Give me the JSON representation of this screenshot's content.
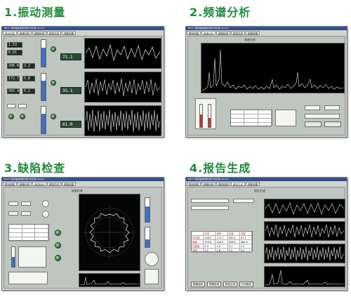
{
  "panels": [
    {
      "heading": "1.振动测量"
    },
    {
      "heading": "2.频谱分析"
    },
    {
      "heading": "3.缺陷检查"
    },
    {
      "heading": "4.报告生成"
    }
  ],
  "panel1": {
    "title": "BZ47-I滚动轴承故障诊断分析系统 Version",
    "tabs": [
      "振动测量",
      "频谱分析",
      "缺陷检测",
      "报告生成",
      "参数设置"
    ],
    "readouts": [
      "1.53",
      "0.61",
      "206.0",
      "2.2",
      "172.7",
      "5.8",
      "392.4",
      "5.2"
    ],
    "big_values": [
      "72.1",
      "35.1",
      "61.0"
    ]
  },
  "panel2": {
    "title": "BZ47-I滚动轴承故障诊断分析系统 Version",
    "tabs": [
      "振动测量",
      "频谱分析",
      "缺陷检测",
      "报告生成",
      "参数设置"
    ],
    "header": "频谱分析"
  },
  "panel3": {
    "title": "BZ47-I滚动轴承故障诊断分析系统 Version",
    "tabs": [
      "振动测量",
      "频谱分析",
      "缺陷检测",
      "报告生成",
      "参数设置"
    ],
    "header": "缺陷检查"
  },
  "panel4": {
    "title": "BZ47-I滚动轴承故障诊断分析系统 Version",
    "tabs": [
      "振动测量",
      "频谱分析",
      "缺陷检测",
      "报告生成",
      "参数设置"
    ],
    "header": "报告生成",
    "table_header": [
      "",
      "时间",
      "频率",
      "外圈",
      "内圈"
    ],
    "table_rows": [
      [
        "时间频",
        "136.0",
        "172.7",
        "392.4",
        "57.1"
      ],
      [
        "幅值",
        "133.8",
        "204.0",
        "426.6",
        "464.5"
      ],
      [
        "加速度",
        "2.3",
        "3.5",
        "5.1",
        "2.2"
      ],
      [
        "速度",
        "2.2",
        "2.8",
        "5.2",
        "5.2"
      ]
    ],
    "buttons": [
      "数据保存",
      "数据查询",
      "报告生成",
      "打印报告"
    ]
  }
}
